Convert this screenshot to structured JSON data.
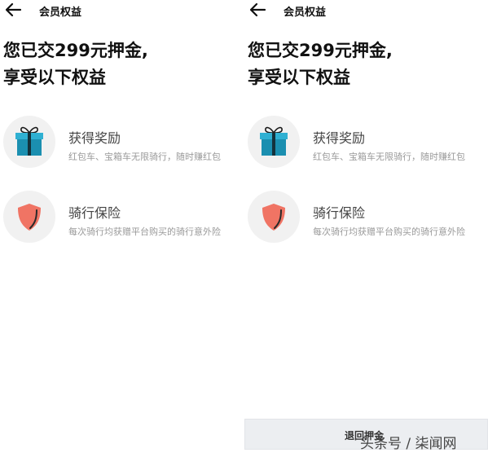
{
  "header": {
    "title": "会员权益"
  },
  "headline": {
    "line1": "您已交299元押金,",
    "line2": "享受以下权益"
  },
  "benefits": [
    {
      "title": "获得奖励",
      "desc": "红包车、宝箱车无限骑行，随时赚红包",
      "icon": "gift-icon"
    },
    {
      "title": "骑行保险",
      "desc": "每次骑行均获赠平台购买的骑行意外险",
      "icon": "shield-icon"
    }
  ],
  "refund_button": {
    "label": "退回押金"
  },
  "watermark": "头条号 / 柒闻网",
  "colors": {
    "gift_blue": "#1b8fb0",
    "gift_lid": "#2fb0d2",
    "shield_red": "#f07464",
    "shield_edge": "#2a2a2a",
    "button_bg": "#eceef1"
  }
}
